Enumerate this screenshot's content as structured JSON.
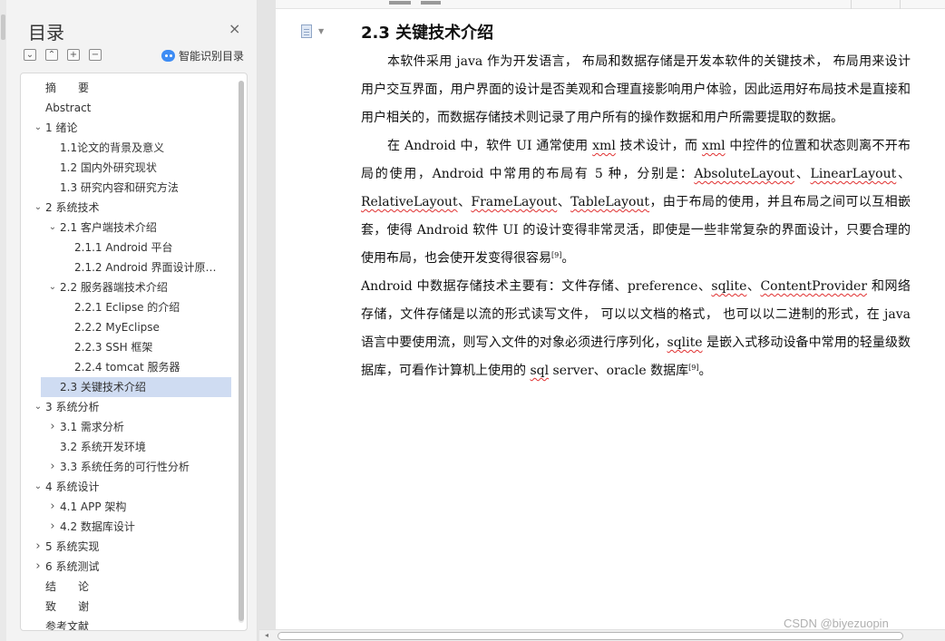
{
  "nav": {
    "title": "目录",
    "close_glyph": "×",
    "tool_icons": [
      "collapse-all-icon",
      "expand-all-icon",
      "add-level-icon",
      "remove-level-icon"
    ],
    "tool_glyphs": [
      "⌄",
      "⌃",
      "+",
      "−"
    ],
    "smart_toc_label": "智能识别目录",
    "items": [
      {
        "label": "摘　　要",
        "level": 0,
        "caret": ""
      },
      {
        "label": "Abstract",
        "level": 0,
        "caret": ""
      },
      {
        "label": "1 绪论",
        "level": 0,
        "caret": "v"
      },
      {
        "label": "1.1论文的背景及意义",
        "level": 1,
        "caret": ""
      },
      {
        "label": "1.2 国内外研究现状",
        "level": 1,
        "caret": ""
      },
      {
        "label": "1.3  研究内容和研究方法",
        "level": 1,
        "caret": ""
      },
      {
        "label": "2 系统技术",
        "level": 0,
        "caret": "v"
      },
      {
        "label": "2.1 客户端技术介绍",
        "level": 1,
        "caret": "v"
      },
      {
        "label": "2.1.1 Android  平台",
        "level": 2,
        "caret": ""
      },
      {
        "label": "2.1.2 Android  界面设计原…",
        "level": 2,
        "caret": ""
      },
      {
        "label": "2.2 服务器端技术介绍",
        "level": 1,
        "caret": "v"
      },
      {
        "label": "2.2.1 Eclipse  的介绍",
        "level": 2,
        "caret": ""
      },
      {
        "label": "2.2.2 MyEclipse",
        "level": 2,
        "caret": ""
      },
      {
        "label": "2.2.3 SSH  框架",
        "level": 2,
        "caret": ""
      },
      {
        "label": "2.2.4 tomcat  服务器",
        "level": 2,
        "caret": ""
      },
      {
        "label": "2.3  关键技术介绍",
        "level": 1,
        "caret": "",
        "selected": true
      },
      {
        "label": "3 系统分析",
        "level": 0,
        "caret": "v"
      },
      {
        "label": "3.1  需求分析",
        "level": 1,
        "caret": ">"
      },
      {
        "label": "3.2    系统开发环境",
        "level": 1,
        "caret": ""
      },
      {
        "label": "3.3    系统任务的可行性分析",
        "level": 1,
        "caret": ">"
      },
      {
        "label": "4 系统设计",
        "level": 0,
        "caret": "v"
      },
      {
        "label": "4.1    APP 架构",
        "level": 1,
        "caret": ">"
      },
      {
        "label": "4.2    数据库设计",
        "level": 1,
        "caret": ">"
      },
      {
        "label": "5 系统实现",
        "level": 0,
        "caret": ">"
      },
      {
        "label": "6 系统测试",
        "level": 0,
        "caret": ">"
      },
      {
        "label": "结　　论",
        "level": 0,
        "caret": ""
      },
      {
        "label": "致　　谢",
        "level": 0,
        "caret": ""
      },
      {
        "label": "参考文献",
        "level": 0,
        "caret": ""
      }
    ]
  },
  "document": {
    "heading": "2.3  关键技术介绍",
    "paragraphs": [
      {
        "indent": true,
        "runs": [
          {
            "t": "本软件采用 java 作为开发语言， 布局和数据存储是开发本软件的关键技术， 布局用来设计用户交互界面，用户界面的设计是否美观和合理直接影响用户体验，因此运用好布局技术是直接和用户相关的，而数据存储技术则记录了用户所有的操作数据和用户所需要提取的数据。"
          }
        ]
      },
      {
        "indent": true,
        "runs": [
          {
            "t": "在 Android 中，软件 UI 通常使用 "
          },
          {
            "t": "xml",
            "spell": true
          },
          {
            "t": " 技术设计，而 "
          },
          {
            "t": "xml",
            "spell": true
          },
          {
            "t": " 中控件的位置和状态则离不开布局的使用，Android 中常用的布局有 5 种，分别是："
          },
          {
            "t": "AbsoluteLayout",
            "spell": true
          },
          {
            "t": "、"
          },
          {
            "t": "LinearLayout",
            "spell": true
          },
          {
            "t": "、"
          },
          {
            "t": "RelativeLayout",
            "spell": true
          },
          {
            "t": "、"
          },
          {
            "t": "FrameLayout",
            "spell": true
          },
          {
            "t": "、"
          },
          {
            "t": "TableLayout",
            "spell": true
          },
          {
            "t": "，由于布局的使用，并且布局之间可以互相嵌套，使得 Android 软件 UI 的设计变得非常灵活，即使是一些非常复杂的界面设计，只要合理的使用布局，也会使开发变得很容易"
          },
          {
            "t": "[9]",
            "sup": true
          },
          {
            "t": "。"
          }
        ]
      },
      {
        "indent": false,
        "runs": [
          {
            "t": "Android 中数据存储技术主要有：文件存储、preference、"
          },
          {
            "t": "sqlite",
            "spell": true
          },
          {
            "t": "、"
          },
          {
            "t": "ContentProvider",
            "spell": true
          },
          {
            "t": " 和网络存储，文件存储是以流的形式读写文件， 可以以文档的格式， 也可以以二进制的形式，在 java 语言中要使用流，则写入文件的对象必须进行序列化，"
          },
          {
            "t": "sqlite",
            "spell": true
          },
          {
            "t": " 是嵌入式移动设备中常用的轻量级数据库，可看作计算机上使用的 "
          },
          {
            "t": "sql",
            "spell": true
          },
          {
            "t": " server、oracle 数据库"
          },
          {
            "t": "[9]",
            "sup": true
          },
          {
            "t": "。"
          }
        ]
      }
    ]
  },
  "watermark": "CSDN @biyezuopin",
  "colors": {
    "selection": "#cfdcf2",
    "accent": "#3d8cf4",
    "spellcheck": "#e03030",
    "pane": "#f3f3f3"
  }
}
